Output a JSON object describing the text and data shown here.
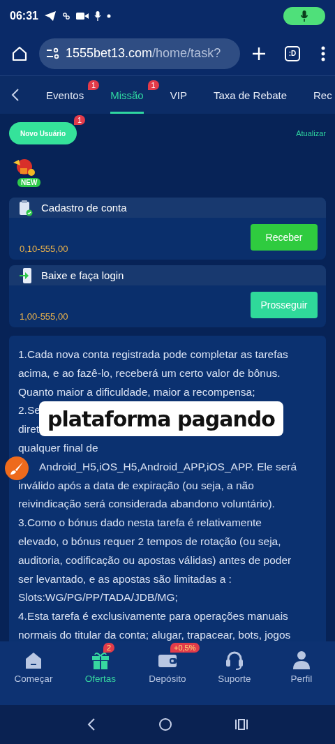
{
  "status_bar": {
    "time": "06:31"
  },
  "address_bar": {
    "domain": "1555bet13.com",
    "path": "/home/task?",
    "tab_button": ":D"
  },
  "tabs": [
    {
      "label": "Eventos",
      "selected": false,
      "badge": "1"
    },
    {
      "label": "Missão",
      "selected": true,
      "badge": "1"
    },
    {
      "label": "VIP",
      "selected": false
    },
    {
      "label": "Taxa de Rebate",
      "selected": false
    },
    {
      "label": "Rec",
      "selected": false
    }
  ],
  "category": {
    "label": "Novo Usuário",
    "badge": "1",
    "selected": true
  },
  "refresh_link": "Atualizar",
  "new_badge": "NEW",
  "tasks": [
    {
      "title": "Cadastro de conta",
      "range": "0,10-555,00",
      "button": "Receber",
      "kind": "claim"
    },
    {
      "title": "Baixe e faça login",
      "range": "1,00-555,00",
      "button": "Prosseguir",
      "kind": "proceed"
    }
  ],
  "rules_lines": [
    "1.Cada nova conta registrada pode completar as tarefas",
    "acima, e ao fazê-lo, receberá um certo valor de bônus.",
    "Quanto maior a dificuldade, maior a recompensa;",
    "2.Se",
    "diret",
    "qualquer final de",
    "Android_H5,iOS_H5,Android_APP,iOS_APP. Ele será",
    "inválido após a data de expiração (ou seja, a não",
    "reivindicação será considerada abandono voluntário).",
    "3.Como o bónus dado nesta tarefa é relativamente",
    "elevado, o bónus requer 2 tempos de rotação (ou seja,",
    "auditoria, codificação ou apostas válidas) antes de poder",
    "ser levantado, e as apostas são limitadas a :",
    "Slots:WG/PG/PP/TADA/JDB/MG;",
    "4.Esta tarefa é exclusivamente para operações manuais",
    "normais do titular da conta; alugar, trapacear, bots, jogos"
  ],
  "caption": "plataforma pagando",
  "bottom_nav": [
    {
      "label": "Começar",
      "selected": false
    },
    {
      "label": "Ofertas",
      "selected": true,
      "badge": "2"
    },
    {
      "label": "Depósito",
      "selected": false,
      "badge": "+0,5%"
    },
    {
      "label": "Suporte",
      "selected": false
    },
    {
      "label": "Perfil",
      "selected": false
    }
  ]
}
